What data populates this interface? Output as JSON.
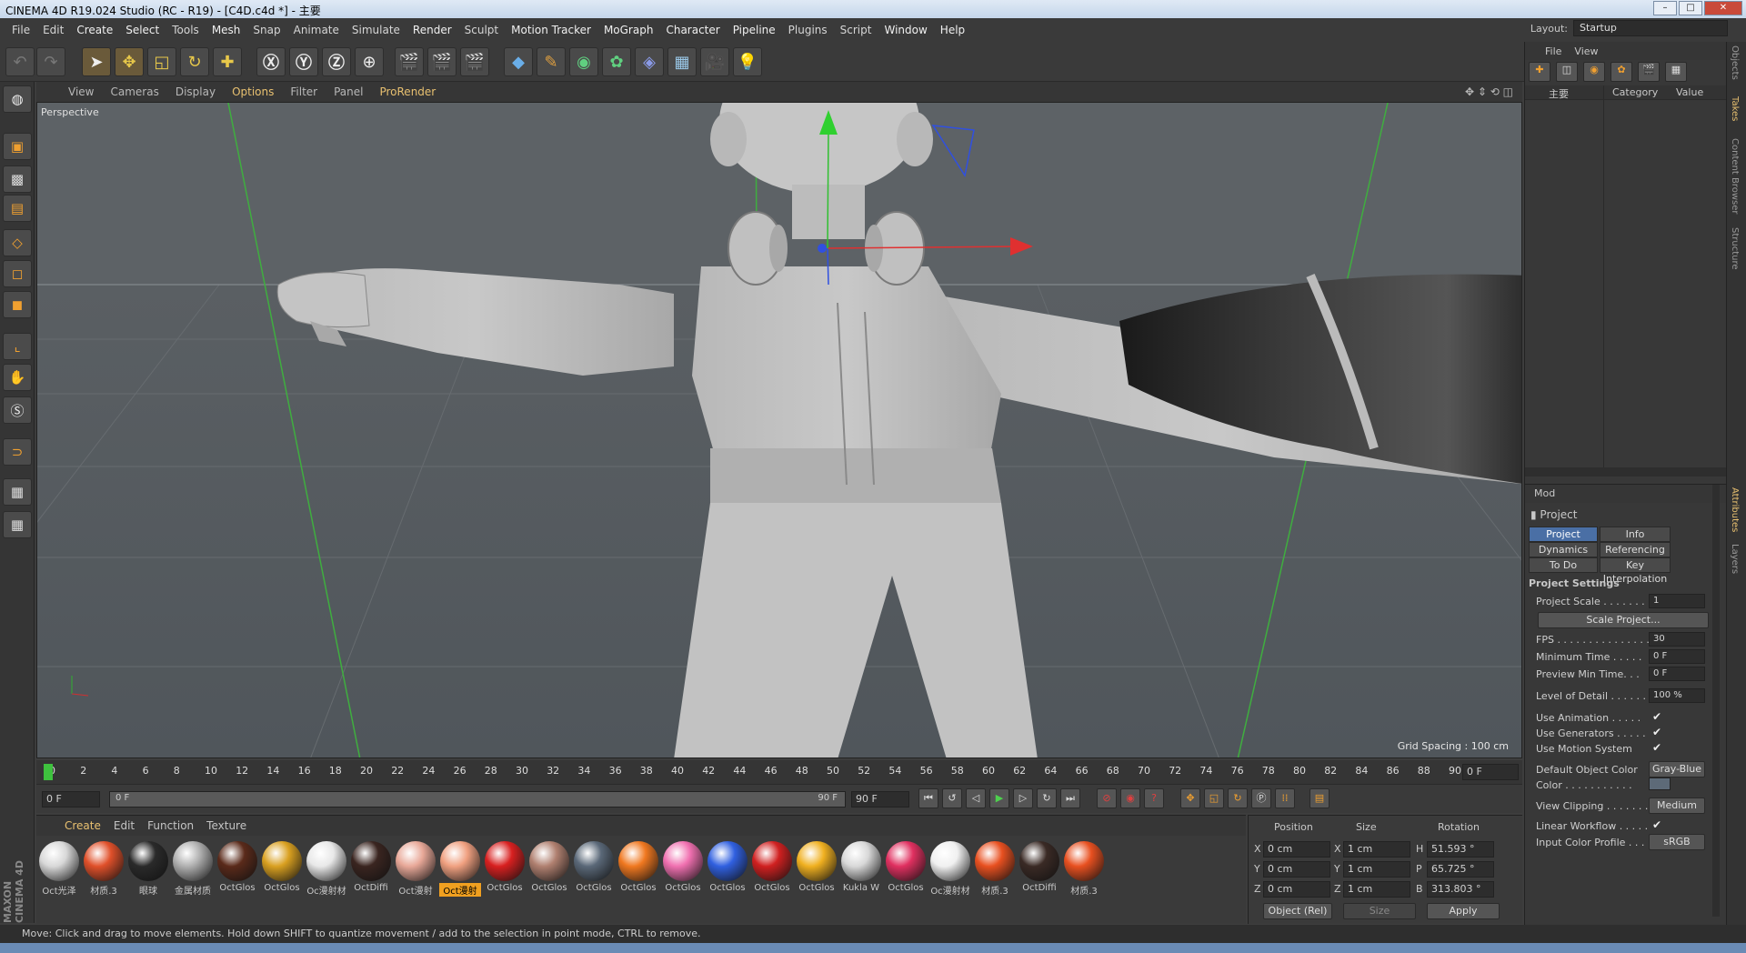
{
  "window": {
    "title": "CINEMA 4D R19.024 Studio (RC - R19) - [C4D.c4d *] - 主要",
    "buttons": [
      "–",
      "□",
      "✕"
    ]
  },
  "menubar": {
    "items": [
      "File",
      "Edit",
      "Create",
      "Select",
      "Tools",
      "Mesh",
      "Snap",
      "Animate",
      "Simulate",
      "Render",
      "Sculpt",
      "Motion Tracker",
      "MoGraph",
      "Character",
      "Pipeline",
      "Plugins",
      "Script",
      "Window",
      "Help"
    ]
  },
  "layout": {
    "label": "Layout:",
    "value": "Startup"
  },
  "viewport": {
    "menu": [
      "View",
      "Cameras",
      "Display",
      "Options",
      "Filter",
      "Panel",
      "ProRender"
    ],
    "label": "Perspective",
    "grid_spacing": "Grid Spacing : 100 cm"
  },
  "timeline": {
    "ticks": [
      "0",
      "2",
      "4",
      "6",
      "8",
      "10",
      "12",
      "14",
      "16",
      "18",
      "20",
      "22",
      "24",
      "26",
      "28",
      "30",
      "32",
      "34",
      "36",
      "38",
      "40",
      "42",
      "44",
      "46",
      "48",
      "50",
      "52",
      "54",
      "56",
      "58",
      "60",
      "62",
      "64",
      "66",
      "68",
      "70",
      "72",
      "74",
      "76",
      "78",
      "80",
      "82",
      "84",
      "86",
      "88",
      "90"
    ],
    "current_frame": "0 F",
    "start_frame": "0 F",
    "range_start": "0 F",
    "range_end": "90 F",
    "end_frame": "90 F"
  },
  "materials": {
    "menu": [
      "Create",
      "Edit",
      "Function",
      "Texture"
    ],
    "items": [
      {
        "name": "Oct光泽",
        "color": "#d8d8d8"
      },
      {
        "name": "材质.3",
        "color": "#e0502a"
      },
      {
        "name": "眼球",
        "color": "#2a2a2a"
      },
      {
        "name": "金属材质",
        "color": "#b0b0b0"
      },
      {
        "name": "OctGlos",
        "color": "#5a2a1a"
      },
      {
        "name": "OctGlos",
        "color": "#d9a020"
      },
      {
        "name": "Oc漫射材",
        "color": "#e8e8e8"
      },
      {
        "name": "OctDiffi",
        "color": "#3a2520"
      },
      {
        "name": "Oct漫射",
        "color": "#e8a898"
      },
      {
        "name": "Oct漫射",
        "color": "#f0a080"
      },
      {
        "name": "OctGlos",
        "color": "#d82020"
      },
      {
        "name": "OctGlos",
        "color": "#b08070"
      },
      {
        "name": "OctGlos",
        "color": "#5a6878"
      },
      {
        "name": "OctGlos",
        "color": "#f07820"
      },
      {
        "name": "OctGlos",
        "color": "#f070b0"
      },
      {
        "name": "OctGlos",
        "color": "#3060e0"
      },
      {
        "name": "OctGlos",
        "color": "#d02020"
      },
      {
        "name": "OctGlos",
        "color": "#f0b020"
      },
      {
        "name": "Kukla W",
        "color": "#d8d8d8"
      },
      {
        "name": "OctGlos",
        "color": "#e03060"
      },
      {
        "name": "Oc漫射材",
        "color": "#f0f0f0"
      },
      {
        "name": "材质.3",
        "color": "#e85020"
      },
      {
        "name": "OctDiffi",
        "color": "#3a2a25"
      },
      {
        "name": "材质.3",
        "color": "#e85020"
      }
    ],
    "selected_index": 9
  },
  "coordinates": {
    "headers": [
      "Position",
      "Size",
      "Rotation"
    ],
    "rows": [
      {
        "axis": "X",
        "pos": "0 cm",
        "size_axis": "X",
        "size": "1 cm",
        "rot_axis": "H",
        "rot": "51.593 °"
      },
      {
        "axis": "Y",
        "pos": "0 cm",
        "size_axis": "Y",
        "size": "1 cm",
        "rot_axis": "P",
        "rot": "65.725 °"
      },
      {
        "axis": "Z",
        "pos": "0 cm",
        "size_axis": "Z",
        "size": "1 cm",
        "rot_axis": "B",
        "rot": "313.803 °"
      }
    ],
    "mode": "Object (Rel)",
    "size_mode": "Size",
    "apply": "Apply"
  },
  "objects": {
    "menu": [
      "File",
      "View"
    ],
    "columns": [
      "主要",
      "Category",
      "Value"
    ]
  },
  "attributes": {
    "mode": "Mod",
    "title": "Project",
    "tabs": [
      "Project Settings",
      "Info",
      "Dynamics",
      "Referencing",
      "To Do",
      "Key Interpolation"
    ],
    "section": "Project Settings",
    "project_scale_label": "Project Scale . . . . . . .",
    "project_scale": "1",
    "scale_button": "Scale Project...",
    "fps_label": "FPS . . . . . . . . . . . . . . .",
    "fps": "30",
    "min_time_label": "Minimum Time . . . . .",
    "min_time": "0 F",
    "preview_min_label": "Preview Min Time. . .",
    "preview_min": "0 F",
    "lod_label": "Level of Detail . . . . . .",
    "lod": "100 %",
    "use_anim_label": "Use Animation . . . . .",
    "use_gen_label": "Use Generators . . . . .",
    "use_motion_label": "Use Motion System",
    "default_color_label": "Default Object Color",
    "default_color": "Gray-Blue",
    "color_label": "Color . . . . . . . . . . .",
    "view_clip_label": "View Clipping . . . . . . .",
    "view_clip": "Medium",
    "linear_label": "Linear Workflow . . . . .",
    "input_profile_label": "Input Color Profile . . .",
    "input_profile": "sRGB"
  },
  "side_tabs": [
    "Objects",
    "Takes",
    "Content Browser",
    "Structure",
    "Attributes",
    "Layers"
  ],
  "status": "Move: Click and drag to move elements. Hold down SHIFT to quantize movement / add to the selection in point mode, CTRL to remove.",
  "brand": "MAXON CINEMA 4D"
}
